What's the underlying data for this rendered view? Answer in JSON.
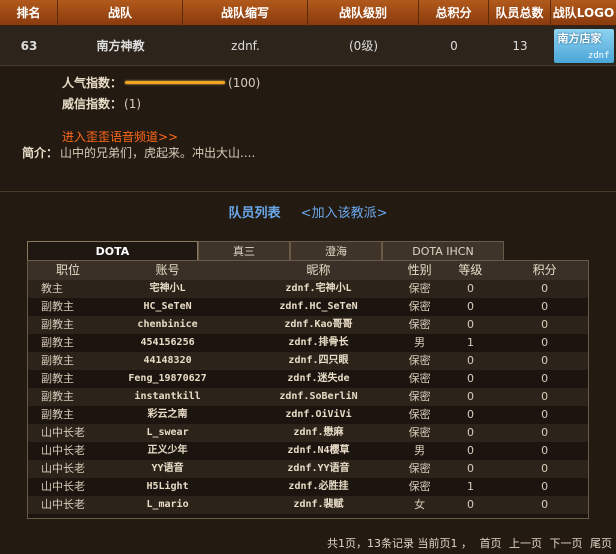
{
  "header": {
    "columns": [
      "排名",
      "战队",
      "战队缩写",
      "战队级别",
      "总积分",
      "队员总数",
      "战队LOGO"
    ]
  },
  "team": {
    "rank": "63",
    "name": "南方神教",
    "abbr": "zdnf.",
    "level": "(0级)",
    "points": "0",
    "members": "13",
    "logo_text": "南方店家",
    "logo_sub": "zdnf"
  },
  "info": {
    "popularity_label": "人气指数：",
    "popularity_value": "(100)",
    "popularity_fill": 1.0,
    "prestige_label": "威信指数：",
    "prestige_value": "(1)",
    "voice_link": "进入歪歪语音频道>>",
    "intro_label": "简介：",
    "intro_text": "山中的兄弟们，虎起来。冲出大山...."
  },
  "members_section": {
    "title": "队员列表",
    "join": "<加入该教派>"
  },
  "tabs": [
    "DOTA",
    "真三",
    "澄海",
    "DOTA IHCN"
  ],
  "table": {
    "headers": [
      "职位",
      "账号",
      "昵称",
      "性别",
      "等级",
      "积分"
    ],
    "rows": [
      [
        "教主",
        "宅神小L",
        "zdnf.宅神小L",
        "保密",
        "0",
        "0"
      ],
      [
        "副教主",
        "HC_SeTeN",
        "zdnf.HC_SeTeN",
        "保密",
        "0",
        "0"
      ],
      [
        "副教主",
        "chenbinice",
        "zdnf.Kao哥哥",
        "保密",
        "0",
        "0"
      ],
      [
        "副教主",
        "454156256",
        "zdnf.排骨长",
        "男",
        "1",
        "0"
      ],
      [
        "副教主",
        "44148320",
        "zdnf.四只眼",
        "保密",
        "0",
        "0"
      ],
      [
        "副教主",
        "Feng_19870627",
        "zdnf.迷失de",
        "保密",
        "0",
        "0"
      ],
      [
        "副教主",
        "instantkill",
        "zdnf.SoBerliN",
        "保密",
        "0",
        "0"
      ],
      [
        "副教主",
        "彩云之南",
        "zdnf.OiViVi",
        "保密",
        "0",
        "0"
      ],
      [
        "山中长老",
        "L_swear",
        "zdnf.懋麻",
        "保密",
        "0",
        "0"
      ],
      [
        "山中长老",
        "正义少年",
        "zdnf.N4樱草",
        "男",
        "0",
        "0"
      ],
      [
        "山中长老",
        "YY语音",
        "zdnf.YY语音",
        "保密",
        "0",
        "0"
      ],
      [
        "山中长老",
        "H5Light",
        "zdnf.必胜挂",
        "保密",
        "1",
        "0"
      ],
      [
        "山中长老",
        "L_mario",
        "zdnf.裴赋",
        "女",
        "0",
        "0"
      ]
    ]
  },
  "pager": {
    "summary": "共1页，13条记录 当前页1 ，",
    "first": "首页",
    "prev": "上一页",
    "next": "下一页",
    "last": "尾页"
  }
}
